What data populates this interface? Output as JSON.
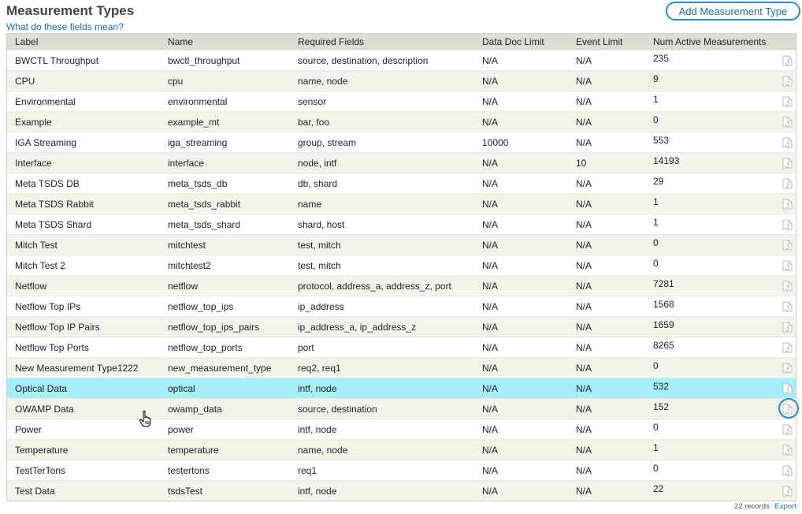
{
  "page": {
    "title": "Measurement Types",
    "help_link": "What do these fields mean?",
    "add_button": "Add Measurement Type"
  },
  "table": {
    "columns": [
      "Label",
      "Name",
      "Required Fields",
      "Data Doc Limit",
      "Event Limit",
      "Num Active Measurements"
    ],
    "selected_index": 16,
    "rows": [
      {
        "label": "BWCTL Throughput",
        "name": "bwctl_throughput",
        "required": "source, destination, description",
        "doc_limit": "N/A",
        "event_limit": "N/A",
        "active": "235"
      },
      {
        "label": "CPU",
        "name": "cpu",
        "required": "name, node",
        "doc_limit": "N/A",
        "event_limit": "N/A",
        "active": "9"
      },
      {
        "label": "Environmental",
        "name": "environmental",
        "required": "sensor",
        "doc_limit": "N/A",
        "event_limit": "N/A",
        "active": "1"
      },
      {
        "label": "Example",
        "name": "example_mt",
        "required": "bar, foo",
        "doc_limit": "N/A",
        "event_limit": "N/A",
        "active": "0"
      },
      {
        "label": "IGA Streaming",
        "name": "iga_streaming",
        "required": "group, stream",
        "doc_limit": "10000",
        "event_limit": "N/A",
        "active": "553"
      },
      {
        "label": "Interface",
        "name": "interface",
        "required": "node, intf",
        "doc_limit": "N/A",
        "event_limit": "10",
        "active": "14193"
      },
      {
        "label": "Meta TSDS DB",
        "name": "meta_tsds_db",
        "required": "db, shard",
        "doc_limit": "N/A",
        "event_limit": "N/A",
        "active": "29"
      },
      {
        "label": "Meta TSDS Rabbit",
        "name": "meta_tsds_rabbit",
        "required": "name",
        "doc_limit": "N/A",
        "event_limit": "N/A",
        "active": "1"
      },
      {
        "label": "Meta TSDS Shard",
        "name": "meta_tsds_shard",
        "required": "shard, host",
        "doc_limit": "N/A",
        "event_limit": "N/A",
        "active": "1"
      },
      {
        "label": "Mitch Test",
        "name": "mitchtest",
        "required": "test, mitch",
        "doc_limit": "N/A",
        "event_limit": "N/A",
        "active": "0"
      },
      {
        "label": "Mitch Test 2",
        "name": "mitchtest2",
        "required": "test, mitch",
        "doc_limit": "N/A",
        "event_limit": "N/A",
        "active": "0"
      },
      {
        "label": "Netflow",
        "name": "netflow",
        "required": "protocol, address_a, address_z, port",
        "doc_limit": "N/A",
        "event_limit": "N/A",
        "active": "7281"
      },
      {
        "label": "Netflow Top IPs",
        "name": "netflow_top_ips",
        "required": "ip_address",
        "doc_limit": "N/A",
        "event_limit": "N/A",
        "active": "1568"
      },
      {
        "label": "Netflow Top IP Pairs",
        "name": "netflow_top_ips_pairs",
        "required": "ip_address_a, ip_address_z",
        "doc_limit": "N/A",
        "event_limit": "N/A",
        "active": "1659"
      },
      {
        "label": "Netflow Top Ports",
        "name": "netflow_top_ports",
        "required": "port",
        "doc_limit": "N/A",
        "event_limit": "N/A",
        "active": "8265"
      },
      {
        "label": "New Measurement Type1222",
        "name": "new_measurement_type",
        "required": "req2, req1",
        "doc_limit": "N/A",
        "event_limit": "N/A",
        "active": "0"
      },
      {
        "label": "Optical Data",
        "name": "optical",
        "required": "intf, node",
        "doc_limit": "N/A",
        "event_limit": "N/A",
        "active": "532"
      },
      {
        "label": "OWAMP Data",
        "name": "owamp_data",
        "required": "source, destination",
        "doc_limit": "N/A",
        "event_limit": "N/A",
        "active": "152"
      },
      {
        "label": "Power",
        "name": "power",
        "required": "intf, node",
        "doc_limit": "N/A",
        "event_limit": "N/A",
        "active": "0"
      },
      {
        "label": "Temperature",
        "name": "temperature",
        "required": "name, node",
        "doc_limit": "N/A",
        "event_limit": "N/A",
        "active": "1"
      },
      {
        "label": "TestTerTons",
        "name": "testertons",
        "required": "req1",
        "doc_limit": "N/A",
        "event_limit": "N/A",
        "active": "0"
      },
      {
        "label": "Test Data",
        "name": "tsdsTest",
        "required": "intf, node",
        "doc_limit": "N/A",
        "event_limit": "N/A",
        "active": "22"
      }
    ]
  },
  "footer": {
    "records": "22 records",
    "export": "Export"
  },
  "icons": {
    "row_action": "document-refresh-icon",
    "cursor": "hand-pointer-icon"
  },
  "colors": {
    "accent": "#2b8ad4",
    "link": "#1a6fb0",
    "header_bg": "#dcdcd4",
    "row_alt_bg": "#f3f3ec",
    "selected_bg": "#a6eef8"
  }
}
